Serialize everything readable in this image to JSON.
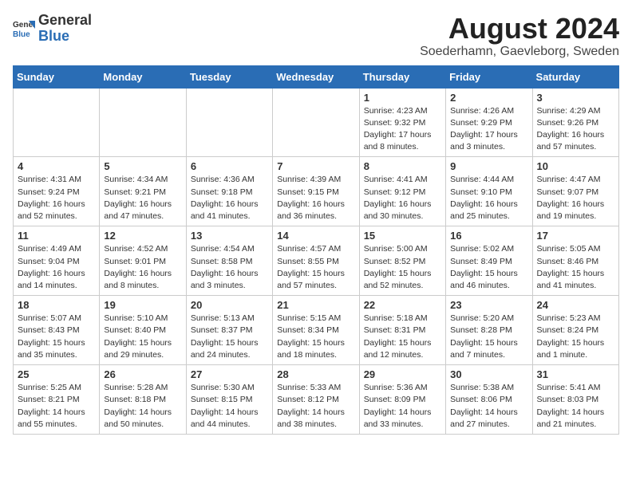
{
  "header": {
    "logo_general": "General",
    "logo_blue": "Blue",
    "month_year": "August 2024",
    "location": "Soederhamn, Gaevleborg, Sweden"
  },
  "days_of_week": [
    "Sunday",
    "Monday",
    "Tuesday",
    "Wednesday",
    "Thursday",
    "Friday",
    "Saturday"
  ],
  "weeks": [
    [
      {
        "day": "",
        "info": ""
      },
      {
        "day": "",
        "info": ""
      },
      {
        "day": "",
        "info": ""
      },
      {
        "day": "",
        "info": ""
      },
      {
        "day": "1",
        "info": "Sunrise: 4:23 AM\nSunset: 9:32 PM\nDaylight: 17 hours\nand 8 minutes."
      },
      {
        "day": "2",
        "info": "Sunrise: 4:26 AM\nSunset: 9:29 PM\nDaylight: 17 hours\nand 3 minutes."
      },
      {
        "day": "3",
        "info": "Sunrise: 4:29 AM\nSunset: 9:26 PM\nDaylight: 16 hours\nand 57 minutes."
      }
    ],
    [
      {
        "day": "4",
        "info": "Sunrise: 4:31 AM\nSunset: 9:24 PM\nDaylight: 16 hours\nand 52 minutes."
      },
      {
        "day": "5",
        "info": "Sunrise: 4:34 AM\nSunset: 9:21 PM\nDaylight: 16 hours\nand 47 minutes."
      },
      {
        "day": "6",
        "info": "Sunrise: 4:36 AM\nSunset: 9:18 PM\nDaylight: 16 hours\nand 41 minutes."
      },
      {
        "day": "7",
        "info": "Sunrise: 4:39 AM\nSunset: 9:15 PM\nDaylight: 16 hours\nand 36 minutes."
      },
      {
        "day": "8",
        "info": "Sunrise: 4:41 AM\nSunset: 9:12 PM\nDaylight: 16 hours\nand 30 minutes."
      },
      {
        "day": "9",
        "info": "Sunrise: 4:44 AM\nSunset: 9:10 PM\nDaylight: 16 hours\nand 25 minutes."
      },
      {
        "day": "10",
        "info": "Sunrise: 4:47 AM\nSunset: 9:07 PM\nDaylight: 16 hours\nand 19 minutes."
      }
    ],
    [
      {
        "day": "11",
        "info": "Sunrise: 4:49 AM\nSunset: 9:04 PM\nDaylight: 16 hours\nand 14 minutes."
      },
      {
        "day": "12",
        "info": "Sunrise: 4:52 AM\nSunset: 9:01 PM\nDaylight: 16 hours\nand 8 minutes."
      },
      {
        "day": "13",
        "info": "Sunrise: 4:54 AM\nSunset: 8:58 PM\nDaylight: 16 hours\nand 3 minutes."
      },
      {
        "day": "14",
        "info": "Sunrise: 4:57 AM\nSunset: 8:55 PM\nDaylight: 15 hours\nand 57 minutes."
      },
      {
        "day": "15",
        "info": "Sunrise: 5:00 AM\nSunset: 8:52 PM\nDaylight: 15 hours\nand 52 minutes."
      },
      {
        "day": "16",
        "info": "Sunrise: 5:02 AM\nSunset: 8:49 PM\nDaylight: 15 hours\nand 46 minutes."
      },
      {
        "day": "17",
        "info": "Sunrise: 5:05 AM\nSunset: 8:46 PM\nDaylight: 15 hours\nand 41 minutes."
      }
    ],
    [
      {
        "day": "18",
        "info": "Sunrise: 5:07 AM\nSunset: 8:43 PM\nDaylight: 15 hours\nand 35 minutes."
      },
      {
        "day": "19",
        "info": "Sunrise: 5:10 AM\nSunset: 8:40 PM\nDaylight: 15 hours\nand 29 minutes."
      },
      {
        "day": "20",
        "info": "Sunrise: 5:13 AM\nSunset: 8:37 PM\nDaylight: 15 hours\nand 24 minutes."
      },
      {
        "day": "21",
        "info": "Sunrise: 5:15 AM\nSunset: 8:34 PM\nDaylight: 15 hours\nand 18 minutes."
      },
      {
        "day": "22",
        "info": "Sunrise: 5:18 AM\nSunset: 8:31 PM\nDaylight: 15 hours\nand 12 minutes."
      },
      {
        "day": "23",
        "info": "Sunrise: 5:20 AM\nSunset: 8:28 PM\nDaylight: 15 hours\nand 7 minutes."
      },
      {
        "day": "24",
        "info": "Sunrise: 5:23 AM\nSunset: 8:24 PM\nDaylight: 15 hours\nand 1 minute."
      }
    ],
    [
      {
        "day": "25",
        "info": "Sunrise: 5:25 AM\nSunset: 8:21 PM\nDaylight: 14 hours\nand 55 minutes."
      },
      {
        "day": "26",
        "info": "Sunrise: 5:28 AM\nSunset: 8:18 PM\nDaylight: 14 hours\nand 50 minutes."
      },
      {
        "day": "27",
        "info": "Sunrise: 5:30 AM\nSunset: 8:15 PM\nDaylight: 14 hours\nand 44 minutes."
      },
      {
        "day": "28",
        "info": "Sunrise: 5:33 AM\nSunset: 8:12 PM\nDaylight: 14 hours\nand 38 minutes."
      },
      {
        "day": "29",
        "info": "Sunrise: 5:36 AM\nSunset: 8:09 PM\nDaylight: 14 hours\nand 33 minutes."
      },
      {
        "day": "30",
        "info": "Sunrise: 5:38 AM\nSunset: 8:06 PM\nDaylight: 14 hours\nand 27 minutes."
      },
      {
        "day": "31",
        "info": "Sunrise: 5:41 AM\nSunset: 8:03 PM\nDaylight: 14 hours\nand 21 minutes."
      }
    ]
  ]
}
